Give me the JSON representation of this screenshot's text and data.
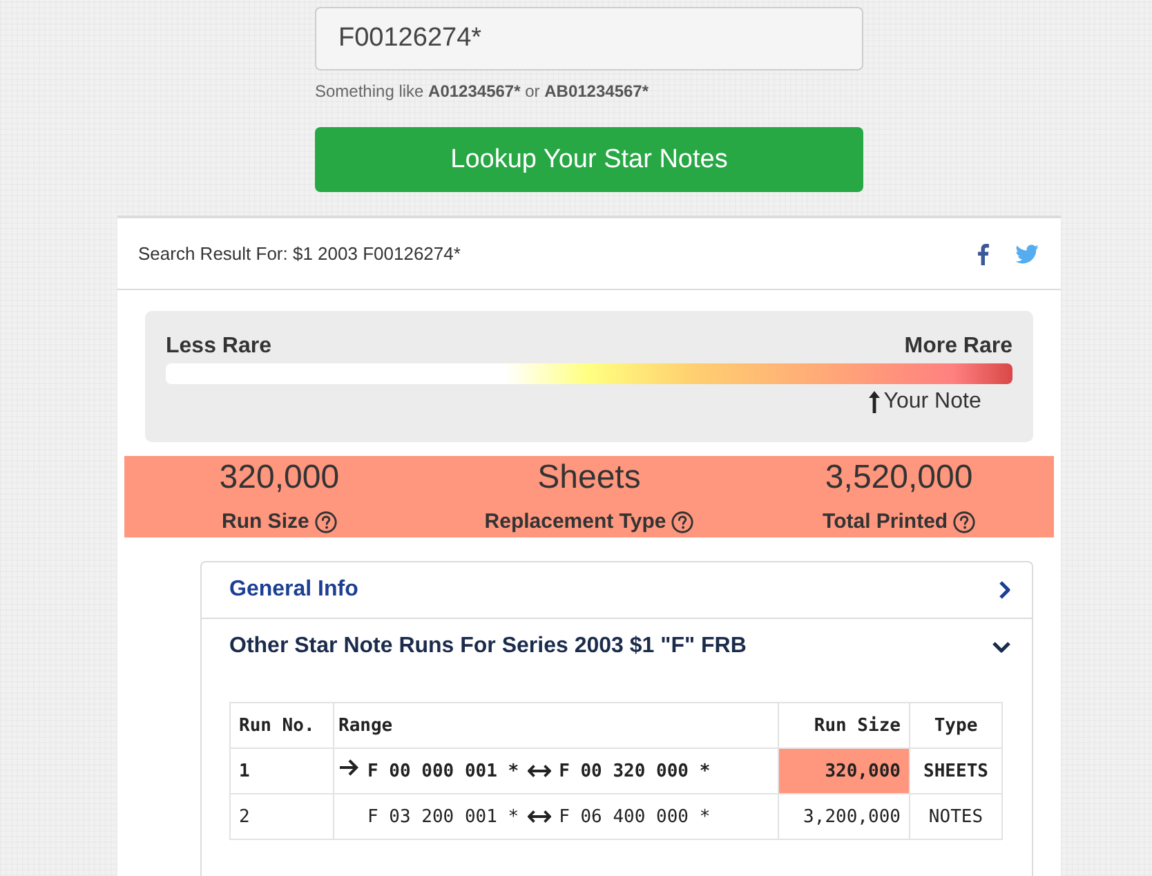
{
  "search": {
    "value": "F00126274*",
    "hint": [
      {
        "text": "Something like ",
        "bold": false
      },
      {
        "text": "A01234567*",
        "bold": true
      },
      {
        "text": " or ",
        "bold": false
      },
      {
        "text": "AB01234567*",
        "bold": true
      }
    ]
  },
  "lookup_button": "Lookup Your Star Notes",
  "result": {
    "title": "Search Result For: $1 2003 F00126274*"
  },
  "rarity": {
    "low_label": "Less Rare",
    "high_label": "More Rare",
    "marker_label": "Your Note",
    "level": 0.83
  },
  "stats": [
    {
      "value": "320,000",
      "label": "Run Size"
    },
    {
      "value": "Sheets",
      "label": "Replacement Type"
    },
    {
      "value": "3,520,000",
      "label": "Total Printed"
    }
  ],
  "sections": [
    {
      "title": "General Info",
      "expanded": false
    },
    {
      "title": "Other Star Note Runs For Series 2003 $1 \"F\" FRB",
      "expanded": true,
      "table": {
        "columns": [
          "Run No.",
          "Range",
          "Run Size",
          "Type"
        ],
        "rows": [
          {
            "run_no": "1",
            "range_start": "F 00 000 001 *",
            "range_end": "F 00 320 000 *",
            "run_size": "320,000",
            "type": "SHEETS",
            "current": true
          },
          {
            "run_no": "2",
            "range_start": "F 03 200 001 *",
            "range_end": "F 06 400 000 *",
            "run_size": "3,200,000",
            "type": "NOTES",
            "current": false
          }
        ]
      }
    }
  ]
}
